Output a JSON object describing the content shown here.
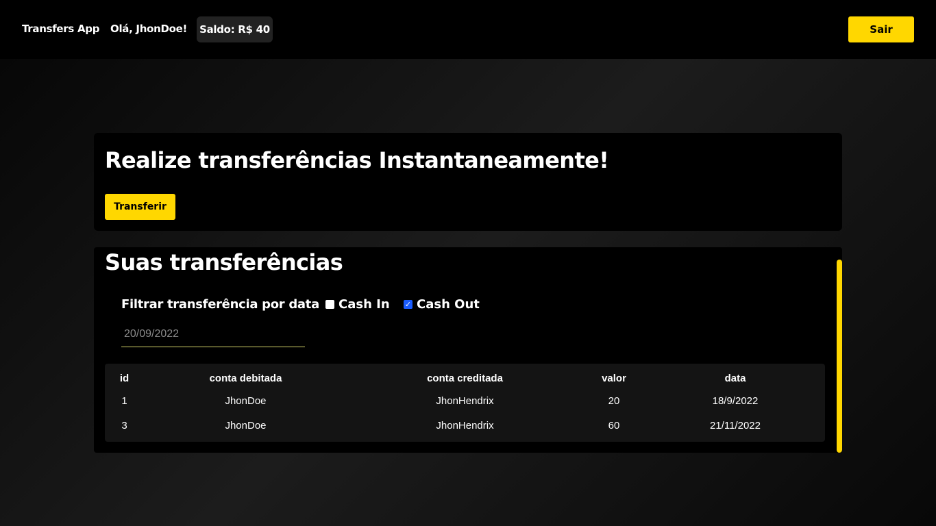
{
  "header": {
    "app_title": "Transfers App",
    "greeting": "Olá, JhonDoe!",
    "balance": "Saldo: R$ 40",
    "logout_label": "Sair"
  },
  "hero": {
    "title": "Realize transferências Instantaneamente!",
    "transfer_label": "Transferir"
  },
  "transfers": {
    "title": "Suas transferências",
    "filter_label": "Filtrar transferência por data",
    "date_value": "20/09/2022",
    "cash_in": {
      "label": "Cash In",
      "checked": false
    },
    "cash_out": {
      "label": "Cash Out",
      "checked": true
    },
    "columns": [
      "id",
      "conta debitada",
      "conta creditada",
      "valor",
      "data"
    ],
    "rows": [
      [
        "1",
        "JhonDoe",
        "JhonHendrix",
        "20",
        "18/9/2022"
      ],
      [
        "3",
        "JhonDoe",
        "JhonHendrix",
        "60",
        "21/11/2022"
      ]
    ]
  },
  "colors": {
    "accent": "#ffd700",
    "background": "#000000",
    "checkbox_checked": "#1a5cff"
  }
}
